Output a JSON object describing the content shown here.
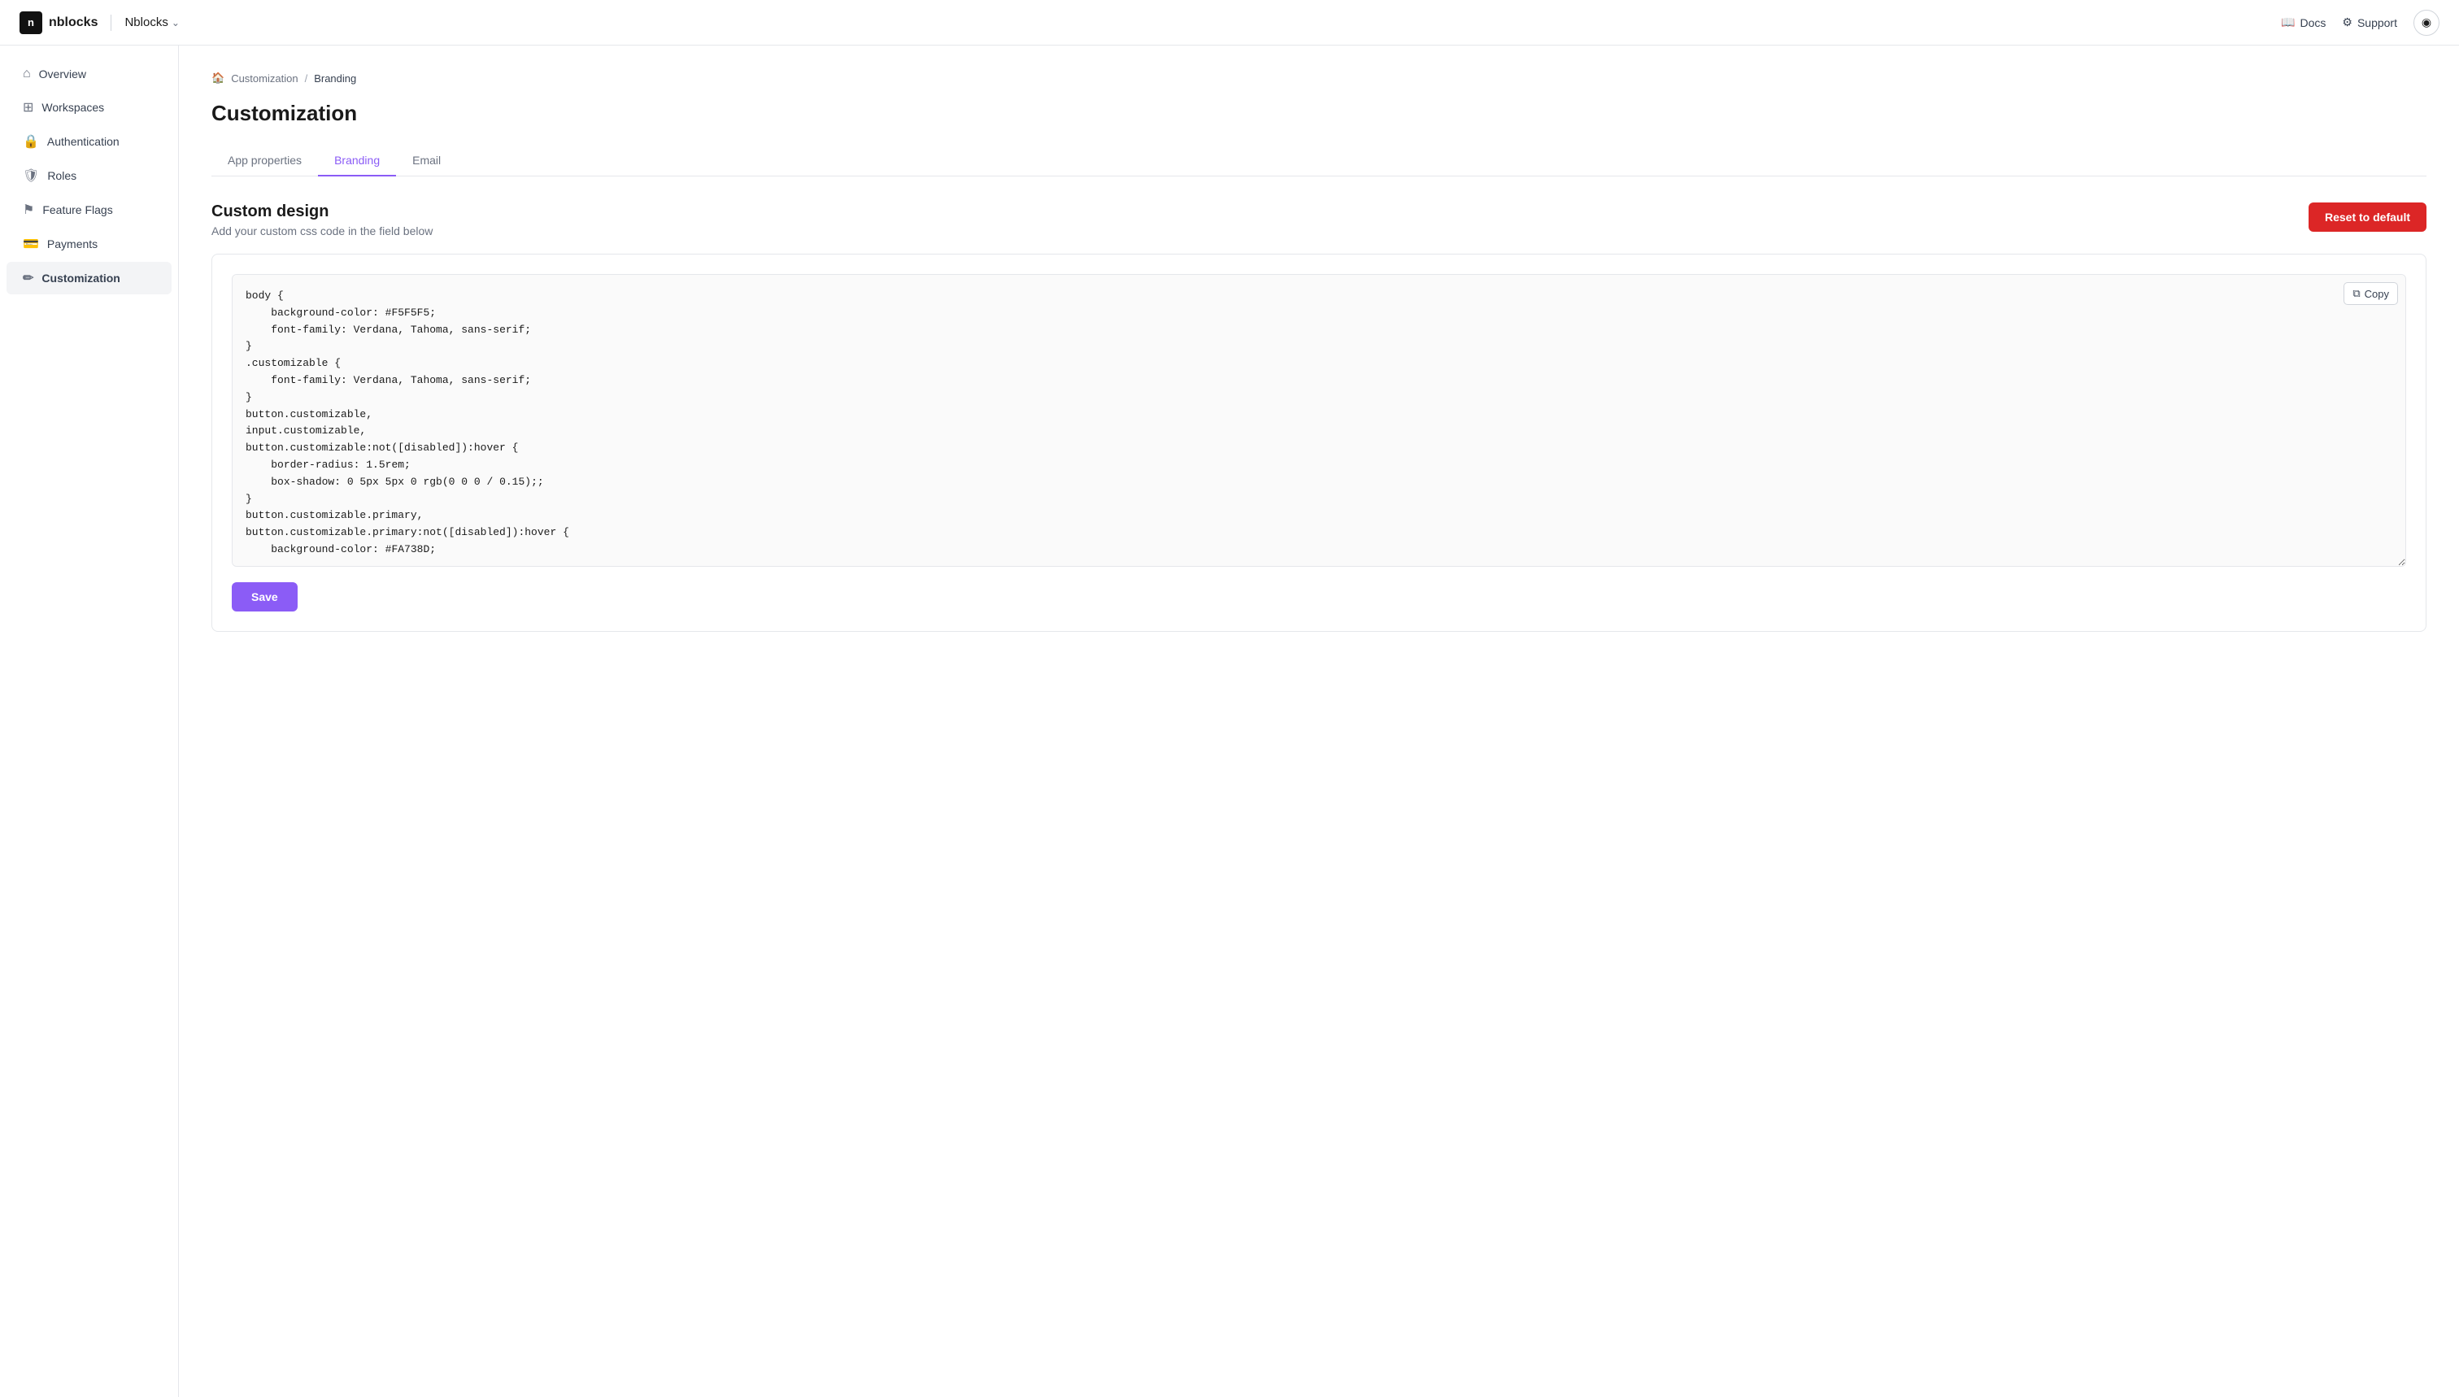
{
  "app": {
    "logo_text": "n",
    "brand_name": "nblocks",
    "app_name": "Nblocks",
    "chevron": "⌄"
  },
  "topnav": {
    "docs_label": "Docs",
    "support_label": "Support"
  },
  "sidebar": {
    "items": [
      {
        "id": "overview",
        "label": "Overview",
        "icon": "home"
      },
      {
        "id": "workspaces",
        "label": "Workspaces",
        "icon": "grid"
      },
      {
        "id": "authentication",
        "label": "Authentication",
        "icon": "lock"
      },
      {
        "id": "roles",
        "label": "Roles",
        "icon": "shield"
      },
      {
        "id": "feature-flags",
        "label": "Feature Flags",
        "icon": "flag"
      },
      {
        "id": "payments",
        "label": "Payments",
        "icon": "card"
      },
      {
        "id": "customization",
        "label": "Customization",
        "icon": "brush",
        "active": true
      }
    ]
  },
  "breadcrumb": {
    "parent": "Customization",
    "current": "Branding"
  },
  "page": {
    "title": "Customization"
  },
  "tabs": [
    {
      "id": "app-properties",
      "label": "App properties",
      "active": false
    },
    {
      "id": "branding",
      "label": "Branding",
      "active": true
    },
    {
      "id": "email",
      "label": "Email",
      "active": false
    }
  ],
  "custom_design": {
    "title": "Custom design",
    "description": "Add your custom css code in the field below",
    "reset_button": "Reset to default",
    "copy_button": "Copy",
    "save_button": "Save",
    "css_code": "body {\n    background-color: #F5F5F5;\n    font-family: Verdana, Tahoma, sans-serif;\n}\n.customizable {\n    font-family: Verdana, Tahoma, sans-serif;\n}\nbutton.customizable,\ninput.customizable,\nbutton.customizable:not([disabled]):hover {\n    border-radius: 1.5rem;\n    box-shadow: 0 5px 5px 0 rgb(0 0 0 / 0.15);;\n}\nbutton.customizable.primary,\nbutton.customizable.primary:not([disabled]):hover {\n    background-color: #FA738D;"
  }
}
